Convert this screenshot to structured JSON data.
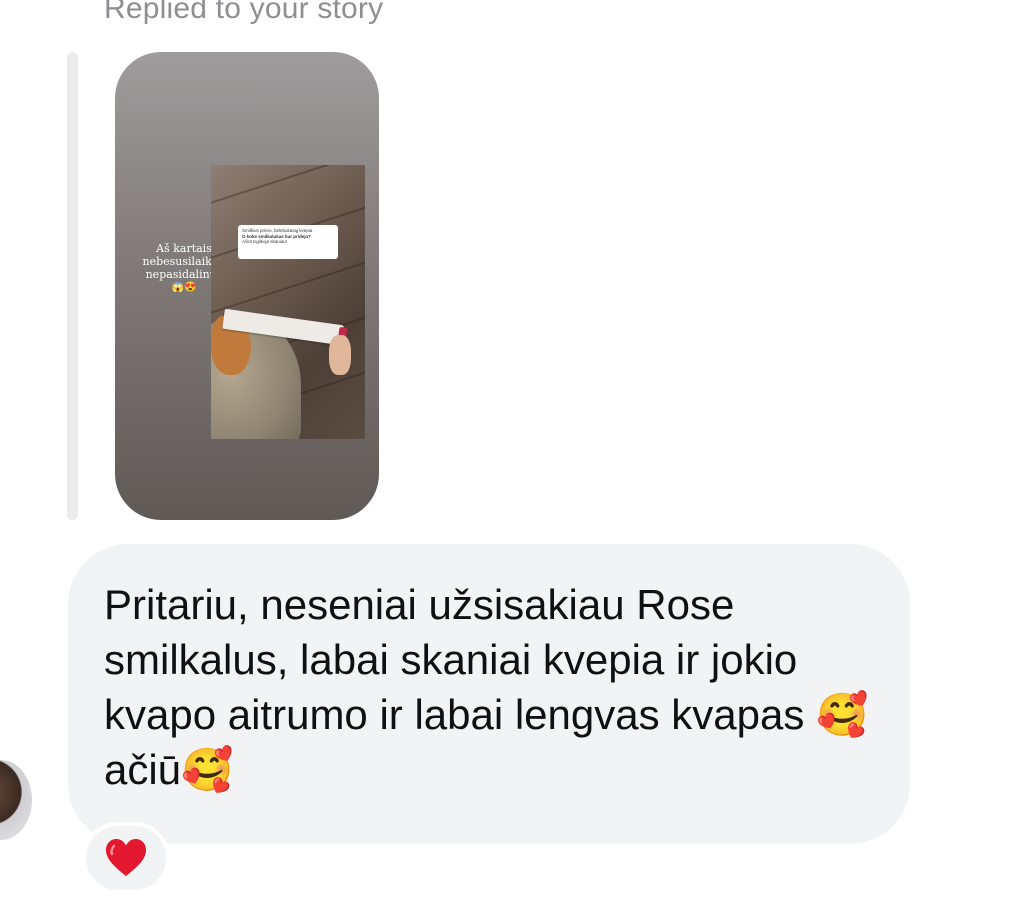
{
  "reply_label": "Replied to your story",
  "story": {
    "caption_line1": "Aš kartais",
    "caption_line2": "nebesusilaikau",
    "caption_line3": "nepasidalinus",
    "caption_emoji": "😱😍",
    "question_line1": "Smilkius prireo, belebukasąj kvepia",
    "question_line2": "O koke smilkalukas kur prideja?",
    "question_line3": "Ačiū! Kglikoja skaniau!"
  },
  "message": {
    "text": "Pritariu, neseniai užsisakiau Rose smilkalus, labai skaniai kvepia ir jokio kvapo aitrumo ir labai lengvas kvapas 🥰 ačiū🥰"
  },
  "reaction": {
    "emoji": "❤️"
  }
}
